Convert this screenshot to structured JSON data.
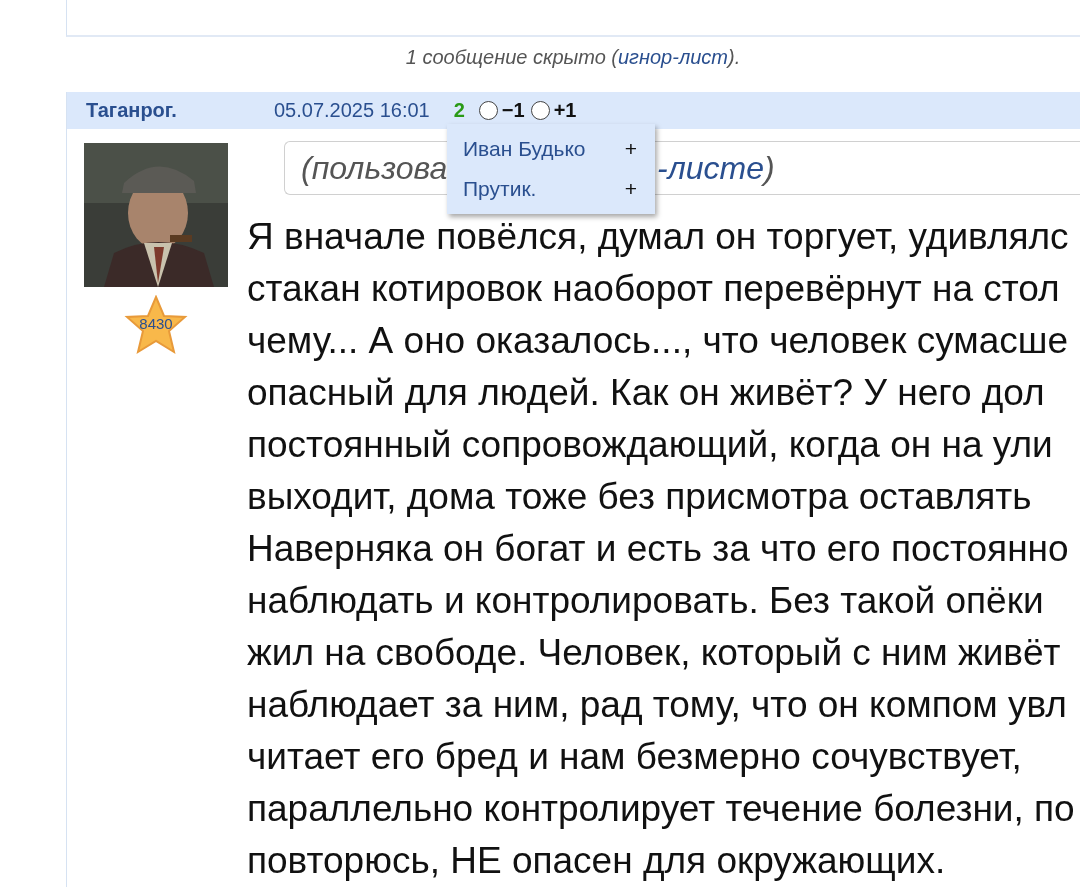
{
  "hidden_notice": {
    "text": "1 сообщение скрыто (",
    "link": "игнор-лист",
    "end": ")."
  },
  "post": {
    "author": "Таганрог.",
    "date": "05.07.2025 16:01",
    "score": "2",
    "votes": [
      {
        "label": "−1",
        "selected": false
      },
      {
        "label": "+1",
        "selected": false
      }
    ],
    "rating": "8430",
    "quote": {
      "start": "(пользова",
      "link_part": "-листе",
      "end": ")"
    },
    "voters_popup": [
      {
        "name": "Иван Будько",
        "action": "+"
      },
      {
        "name": "Прутик.",
        "action": "+"
      }
    ],
    "body_lines": [
      "Я вначале повёлся, думал он торгует, удивлялс",
      "стакан котировок наоборот перевёрнут на стол",
      "чему... А оно оказалось..., что человек сумасше",
      "опасный для людей. Как он живёт? У него дол",
      "постоянный сопровождающий, когда он на ули",
      "выходит, дома тоже без присмотра оставлять",
      "Наверняка он богат и есть за что его постоянно",
      "наблюдать и контролировать. Без такой опёки",
      "жил на свободе. Человек, который с ним живёт",
      "наблюдает за ним, рад тому, что он компом увл",
      "читает его бред и нам безмерно сочувствует,",
      "параллельно контролирует течение болезни, по",
      "повторюсь, НЕ опасен для окружающих."
    ]
  }
}
